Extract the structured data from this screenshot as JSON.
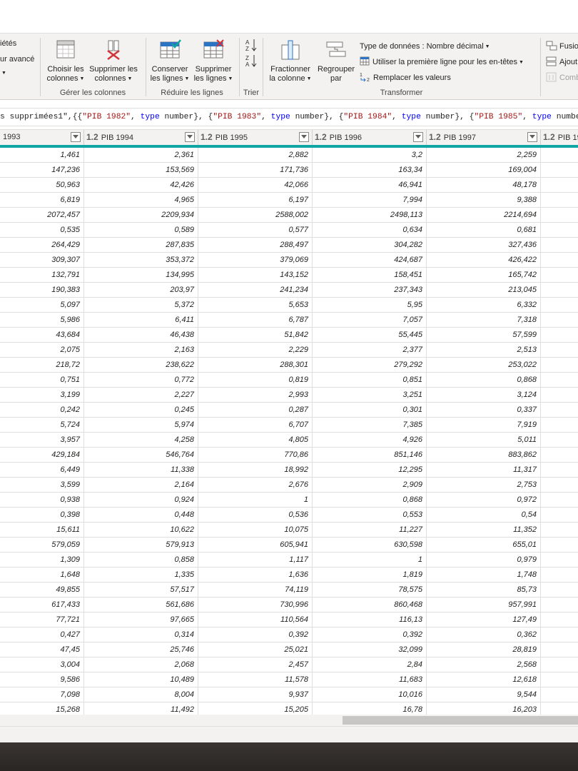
{
  "ribbon": {
    "left_partial": {
      "proprietes": "iétés",
      "editeur_avance": "ur avancé"
    },
    "gerer_colonnes": {
      "choisir": [
        "Choisir les",
        "colonnes"
      ],
      "supprimer": [
        "Supprimer les",
        "colonnes"
      ],
      "label": "Gérer les colonnes"
    },
    "reduire_lignes": {
      "conserver": [
        "Conserver",
        "les lignes"
      ],
      "supprimer": [
        "Supprimer",
        "les lignes"
      ],
      "label": "Réduire les lignes"
    },
    "trier": {
      "label": "Trier"
    },
    "transformer": {
      "fractionner": [
        "Fractionner",
        "la colonne"
      ],
      "regrouper": [
        "Regrouper",
        "par"
      ],
      "data_type": "Type de données : Nombre décimal",
      "first_row": "Utiliser la première ligne pour les en-têtes",
      "replace": "Remplacer les valeurs",
      "label": "Transformer"
    },
    "combiner_partial": {
      "fusion": "Fusio",
      "ajout": "Ajout",
      "comb": "Comb"
    }
  },
  "formula": {
    "prefix": "s supprimées1\",{{",
    "items": [
      {
        "name": "\"PIB 1982\"",
        "kw": "type",
        "t": "number"
      },
      {
        "name": "\"PIB 1983\"",
        "kw": "type",
        "t": "number"
      },
      {
        "name": "\"PIB 1984\"",
        "kw": "type",
        "t": "number"
      },
      {
        "name": "\"PIB 1985\"",
        "kw": "type",
        "t": "number"
      }
    ]
  },
  "colors": {
    "accent_teal": "#11a5a5",
    "string_red": "#a31515",
    "keyword_blue": "#0000ff"
  },
  "table": {
    "type_icon": "1.2",
    "columns": [
      "1993",
      "PIB 1994",
      "PIB 1995",
      "PIB 1996",
      "PIB 1997",
      "PIB 19"
    ],
    "rows": [
      [
        "1,461",
        "2,361",
        "2,882",
        "3,2",
        "2,259"
      ],
      [
        "147,236",
        "153,569",
        "171,736",
        "163,34",
        "169,004"
      ],
      [
        "50,963",
        "42,426",
        "42,066",
        "46,941",
        "48,178"
      ],
      [
        "6,819",
        "4,965",
        "6,197",
        "7,994",
        "9,388"
      ],
      [
        "2072,457",
        "2209,934",
        "2588,002",
        "2498,113",
        "2214,694"
      ],
      [
        "0,535",
        "0,589",
        "0,577",
        "0,634",
        "0,681"
      ],
      [
        "264,429",
        "287,835",
        "288,497",
        "304,282",
        "327,436"
      ],
      [
        "309,307",
        "353,372",
        "379,069",
        "424,687",
        "426,422"
      ],
      [
        "132,791",
        "134,995",
        "143,152",
        "158,451",
        "165,742"
      ],
      [
        "190,383",
        "203,97",
        "241,234",
        "237,343",
        "213,045"
      ],
      [
        "5,097",
        "5,372",
        "5,653",
        "5,95",
        "6,332"
      ],
      [
        "5,986",
        "6,411",
        "6,787",
        "7,057",
        "7,318"
      ],
      [
        "43,684",
        "46,438",
        "51,842",
        "55,445",
        "57,599"
      ],
      [
        "2,075",
        "2,163",
        "2,229",
        "2,377",
        "2,513"
      ],
      [
        "218,72",
        "238,622",
        "288,301",
        "279,292",
        "253,022"
      ],
      [
        "0,751",
        "0,772",
        "0,819",
        "0,851",
        "0,868"
      ],
      [
        "3,199",
        "2,227",
        "2,993",
        "3,251",
        "3,124"
      ],
      [
        "0,242",
        "0,245",
        "0,287",
        "0,301",
        "0,337"
      ],
      [
        "5,724",
        "5,974",
        "6,707",
        "7,385",
        "7,919"
      ],
      [
        "3,957",
        "4,258",
        "4,805",
        "4,926",
        "5,011"
      ],
      [
        "429,184",
        "546,764",
        "770,86",
        "851,146",
        "883,862"
      ],
      [
        "6,449",
        "11,338",
        "18,992",
        "12,295",
        "11,317"
      ],
      [
        "3,599",
        "2,164",
        "2,676",
        "2,909",
        "2,753"
      ],
      [
        "0,938",
        "0,924",
        "1",
        "0,868",
        "0,972"
      ],
      [
        "0,398",
        "0,448",
        "0,536",
        "0,553",
        "0,54"
      ],
      [
        "15,611",
        "10,622",
        "10,075",
        "11,227",
        "11,352"
      ],
      [
        "579,059",
        "579,913",
        "605,941",
        "630,598",
        "655,01"
      ],
      [
        "1,309",
        "0,858",
        "1,117",
        "1",
        "0,979"
      ],
      [
        "1,648",
        "1,335",
        "1,636",
        "1,819",
        "1,748"
      ],
      [
        "49,855",
        "57,517",
        "74,119",
        "78,575",
        "85,73"
      ],
      [
        "617,433",
        "561,686",
        "730,996",
        "860,468",
        "957,991"
      ],
      [
        "77,721",
        "97,665",
        "110,564",
        "116,13",
        "127,49"
      ],
      [
        "0,427",
        "0,314",
        "0,392",
        "0,392",
        "0,362"
      ],
      [
        "47,45",
        "25,746",
        "25,021",
        "32,099",
        "28,819"
      ],
      [
        "3,004",
        "2,068",
        "2,457",
        "2,84",
        "2,568"
      ],
      [
        "9,586",
        "10,489",
        "11,578",
        "11,683",
        "12,618"
      ],
      [
        "7,098",
        "8,004",
        "9,937",
        "10,016",
        "9,544"
      ],
      [
        "15,268",
        "11,492",
        "15,205",
        "16,78",
        "16,203"
      ]
    ]
  }
}
